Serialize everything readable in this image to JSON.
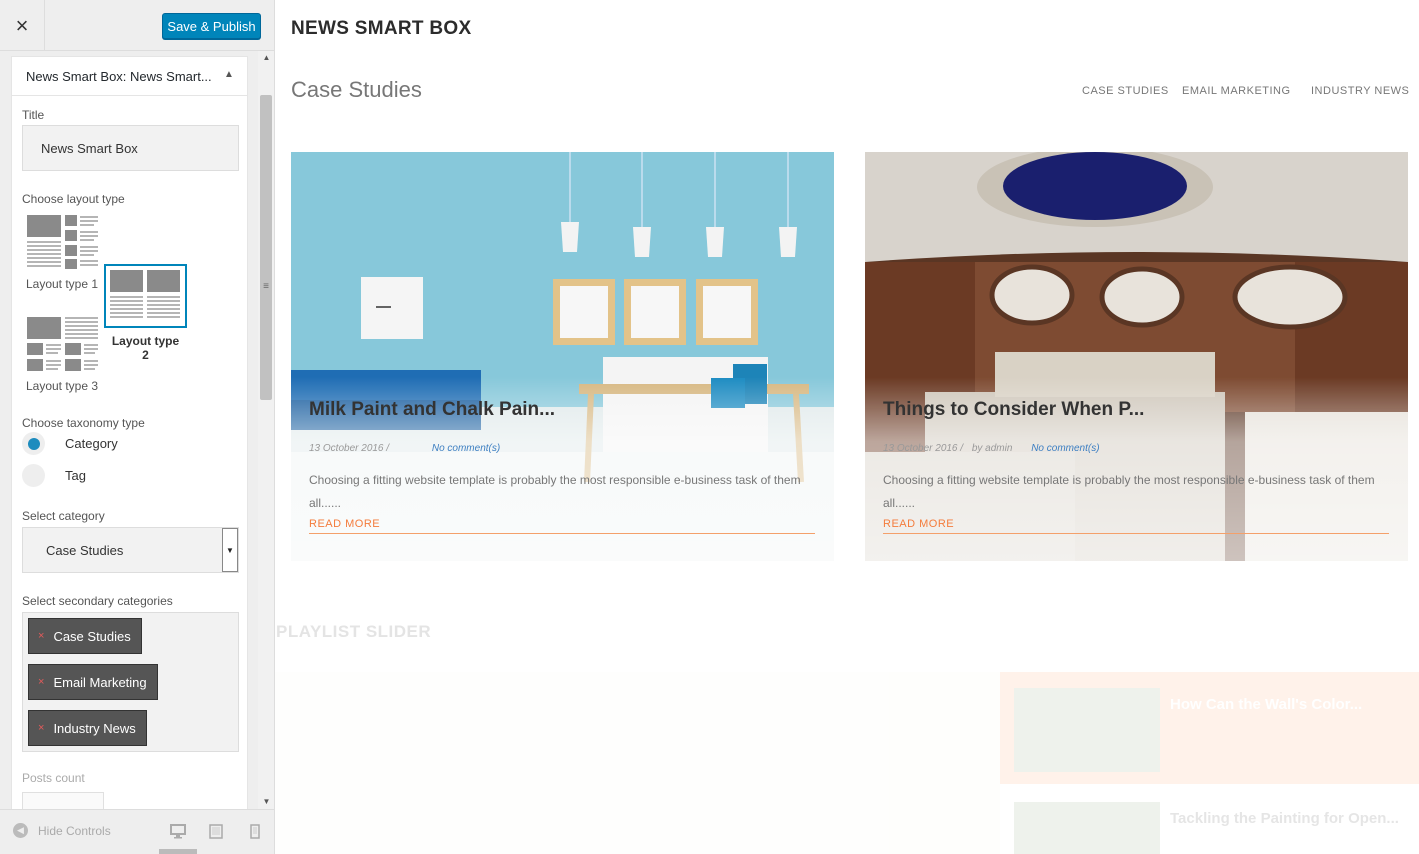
{
  "customizer": {
    "close_icon": "×",
    "publish_label": "Save & Publish",
    "widget_title": "News Smart Box: News Smart...",
    "widget_toggle_icon": "▲",
    "title_label": "Title",
    "title_value": "News Smart Box",
    "layout_label": "Choose layout type",
    "layouts": [
      {
        "label": "Layout type 1",
        "selected": false
      },
      {
        "label": "Layout type 2",
        "selected": true
      },
      {
        "label": "Layout type 3",
        "selected": false
      }
    ],
    "taxonomy_label": "Choose taxonomy type",
    "taxonomy_options": [
      {
        "label": "Category",
        "selected": true
      },
      {
        "label": "Tag",
        "selected": false
      }
    ],
    "category_label": "Select category",
    "category_value": "Case Studies",
    "category_arrow": "▼",
    "secondary_label": "Select secondary categories",
    "secondary_categories": [
      "Case Studies",
      "Email Marketing",
      "Industry News"
    ],
    "chip_remove": "×",
    "posts_count_label": "Posts count",
    "hide_controls_label": "Hide Controls",
    "accent_color": "#0085ba"
  },
  "preview": {
    "section_title": "NEWS SMART BOX",
    "box_heading": "Case Studies",
    "category_tabs": [
      "CASE STUDIES",
      "EMAIL MARKETING",
      "INDUSTRY NEWS"
    ],
    "posts": [
      {
        "title": "Milk Paint and Chalk Pain...",
        "date": "13 October 2016 /",
        "author": "",
        "comments": "No comment(s)",
        "excerpt": "Choosing a fitting website template is probably the most responsible e-business task of them all......",
        "read_more": "READ MORE"
      },
      {
        "title": "Things to Consider When P...",
        "date": "13 October 2016 /",
        "author": "by admin",
        "comments": "No comment(s)",
        "excerpt": "Choosing a fitting website template is probably the most responsible e-business task of them all......",
        "read_more": "READ MORE"
      }
    ],
    "playlist_title": "PLAYLIST SLIDER",
    "playlist_items": [
      "How Can the Wall's Color...",
      "Tackling the Painting for Open..."
    ],
    "accent_color": "#f47c3c"
  }
}
